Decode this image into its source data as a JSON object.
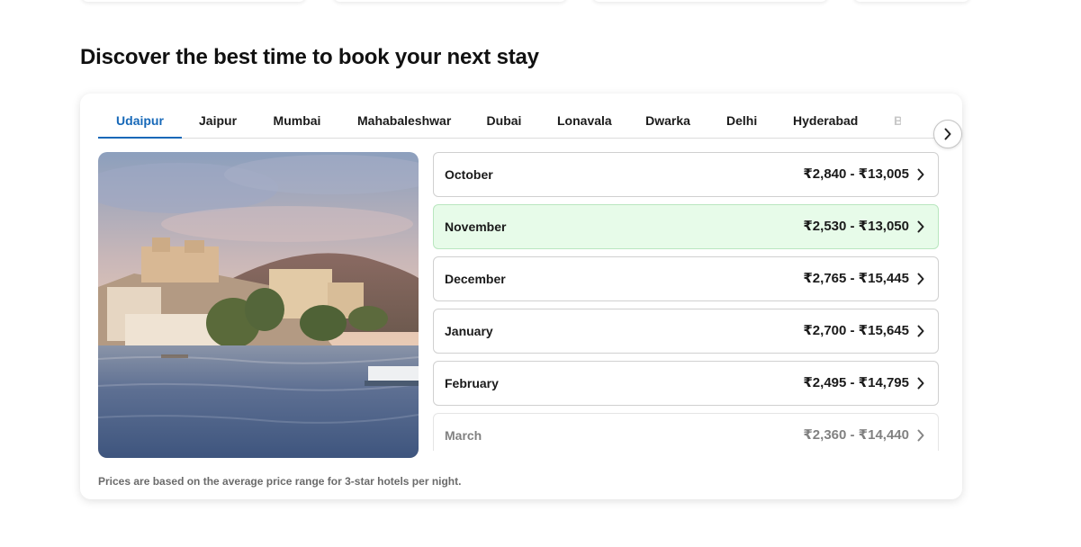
{
  "section": {
    "title": "Discover the best time to book your next stay",
    "footnote": "Prices are based on the average price range for 3-star hotels per night."
  },
  "tabs": [
    {
      "label": "Udaipur",
      "active": true
    },
    {
      "label": "Jaipur",
      "active": false
    },
    {
      "label": "Mumbai",
      "active": false
    },
    {
      "label": "Mahabaleshwar",
      "active": false
    },
    {
      "label": "Dubai",
      "active": false
    },
    {
      "label": "Lonavala",
      "active": false
    },
    {
      "label": "Dwarka",
      "active": false
    },
    {
      "label": "Delhi",
      "active": false
    },
    {
      "label": "Hyderabad",
      "active": false
    },
    {
      "label": "B",
      "active": false
    }
  ],
  "tab_next_icon": "chevron-right-icon",
  "photo_icon": "udaipur-lake-palace-image",
  "months": [
    {
      "name": "October",
      "price": "₹2,840 - ₹13,005",
      "highlight": false
    },
    {
      "name": "November",
      "price": "₹2,530 - ₹13,050",
      "highlight": true
    },
    {
      "name": "December",
      "price": "₹2,765 - ₹15,445",
      "highlight": false
    },
    {
      "name": "January",
      "price": "₹2,700 - ₹15,645",
      "highlight": false
    },
    {
      "name": "February",
      "price": "₹2,495 - ₹14,795",
      "highlight": false
    },
    {
      "name": "March",
      "price": "₹2,360 - ₹14,440",
      "highlight": false
    }
  ],
  "colors": {
    "accent": "#1668b8",
    "highlight_bg": "#e7fbe9"
  }
}
